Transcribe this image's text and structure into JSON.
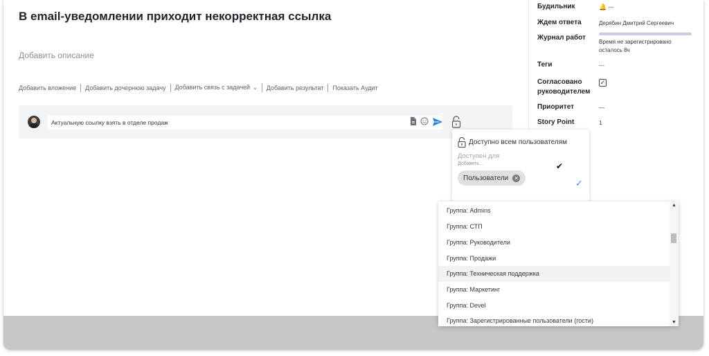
{
  "task": {
    "title": "В email-уведомлении приходит некорректная ссылка",
    "description_placeholder": "Добавить описание"
  },
  "actions": [
    "Добавить вложение",
    "Добавить дочернюю задачу",
    "Добавить связь с задачей",
    "Добавить результат",
    "Показать Аудит"
  ],
  "comment": {
    "text": "Актуальную ссылку взять в отделе продаж",
    "icons": [
      "attachment-icon",
      "emoji-icon",
      "send-icon",
      "lock-icon"
    ]
  },
  "properties": {
    "alarm": {
      "label": "Будильник",
      "value": "---"
    },
    "waiting": {
      "label": "Ждем ответа",
      "value": "Дерябин Дмитрий Сергеевич"
    },
    "worklog": {
      "label": "Журнал работ",
      "line1": "Время не зарегистрировано",
      "line2": "осталось 8ч"
    },
    "tags": {
      "label": "Теги",
      "value": "---"
    },
    "approved": {
      "label_line1": "Согласовано",
      "label_line2": "руководителем",
      "checked": true
    },
    "priority": {
      "label": "Приоритет",
      "value": "—"
    },
    "story_point": {
      "label": "Story Point",
      "value": "1"
    }
  },
  "access_popover": {
    "title": "Доступно всем пользователям",
    "available_for_label": "Доступен для",
    "add_placeholder": "Добавить...",
    "chip": "Пользователи"
  },
  "dropdown": {
    "items": [
      "Группа: Admins",
      "Группа: СТП",
      "Группа: Руководители",
      "Группа: Продажи",
      "Группа: Техническая поддержка",
      "Группа: Маркетинг",
      "Группа: Devel",
      "Группа: Зарегистрированные пользователи (гости)"
    ],
    "highlighted_index": 4
  },
  "colors": {
    "accent": "#4a90e2",
    "send": "#2f7fdc",
    "bell": "#d12b2b",
    "footer": "#c6c6c6"
  }
}
